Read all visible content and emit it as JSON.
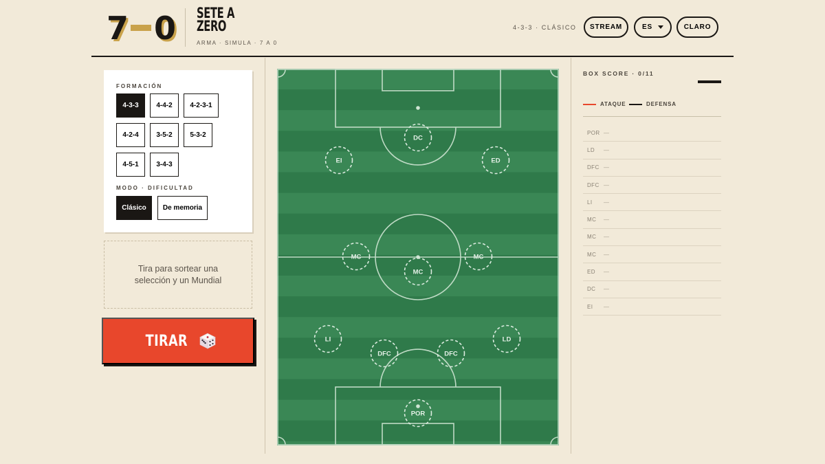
{
  "header": {
    "logo_score_left": "7",
    "logo_score_right": "0",
    "logo_title": "SETE A ZERO",
    "tagline": "ARMA · SIMULA · 7 A 0",
    "status": "4-3-3 · CLÁSICO",
    "stream_label": "STREAM",
    "lang_label": "ES",
    "theme_label": "CLARO"
  },
  "formation": {
    "label": "FORMACIÓN",
    "options": [
      "4-3-3",
      "4-4-2",
      "4-2-3-1",
      "4-2-4",
      "3-5-2",
      "5-3-2",
      "4-5-1",
      "3-4-3"
    ],
    "selected": "4-3-3"
  },
  "mode": {
    "label": "MODO · DIFICULTAD",
    "options": [
      "Clásico",
      "De memoria"
    ],
    "selected": "Clásico"
  },
  "drop_zone_text": "Tira para sortear una selección y un Mundial",
  "roll_button": {
    "label": "TIRAR",
    "icon": "dice-icon"
  },
  "pitch": {
    "positions": [
      "DC",
      "EI",
      "ED",
      "MC",
      "MC",
      "MC",
      "LI",
      "DFC",
      "DFC",
      "LD",
      "POR"
    ]
  },
  "box_score": {
    "title": "BOX SCORE · 0/11",
    "legend": [
      {
        "label": "ATAQUE",
        "color": "#e8472c"
      },
      {
        "label": "DEFENSA",
        "color": "#1a1714"
      }
    ],
    "rows": [
      {
        "pos": "POR",
        "value": "—"
      },
      {
        "pos": "LD",
        "value": "—"
      },
      {
        "pos": "DFC",
        "value": "—"
      },
      {
        "pos": "DFC",
        "value": "—"
      },
      {
        "pos": "LI",
        "value": "—"
      },
      {
        "pos": "MC",
        "value": "—"
      },
      {
        "pos": "MC",
        "value": "—"
      },
      {
        "pos": "MC",
        "value": "—"
      },
      {
        "pos": "ED",
        "value": "—"
      },
      {
        "pos": "DC",
        "value": "—"
      },
      {
        "pos": "EI",
        "value": "—"
      }
    ]
  },
  "colors": {
    "background": "#f2ead9",
    "accent": "#e8472c",
    "pitch_dark": "#2f7a4a",
    "pitch_light": "#3a8755",
    "gold": "#c9a24b"
  }
}
